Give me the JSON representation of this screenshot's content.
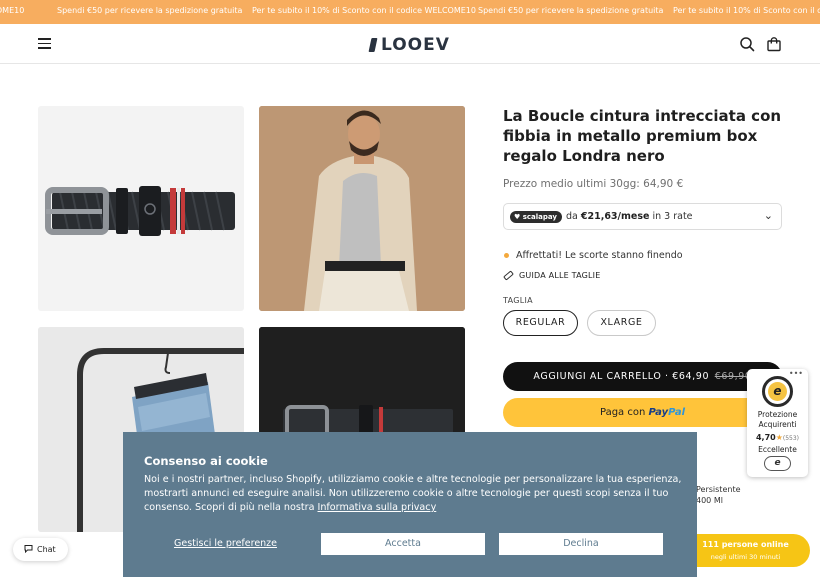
{
  "announcement": {
    "items": [
      "DME10",
      "Spendi €50 per ricevere la spedizione gratuita",
      "Per te subito il 10% di Sconto con il codice WELCOME10",
      "Spendi €50 per ricevere la spedizione gratuita",
      "Per te subito il 10% di Sconto con il codice"
    ],
    "color": "#f7ad5f"
  },
  "header": {
    "logo": "LOOEV",
    "icons": [
      "menu-icon",
      "search-icon",
      "bag-icon"
    ]
  },
  "product": {
    "title": "La Boucle cintura intrecciata con fibbia in metallo premium box regalo Londra nero",
    "avg_price": "Prezzo medio ultimi 30gg: 64,90 €",
    "scalapay": {
      "badge": "scalapay",
      "prefix": "da ",
      "amount": "€21,63/mese",
      "suffix": " in 3 rate"
    },
    "stock": "Affrettati! Le scorte stanno finendo",
    "size_guide": "GUIDA ALLE TAGLIE",
    "size_label": "TAGLIA",
    "sizes": [
      "REGULAR",
      "XLARGE"
    ],
    "add_to_cart": "AGGIUNGI AL CARRELLO · €64,90",
    "old_price": "€69,90",
    "paypal": {
      "prefix": "Paga con ",
      "brand1": "Pay",
      "brand2": "Pal"
    },
    "partial_text": [
      "Persistente",
      "400 Ml"
    ]
  },
  "trust": {
    "seal": "e",
    "label": "Protezione Acquirenti",
    "rating": "4,70",
    "star": "★",
    "count": "(553)",
    "quality": "Eccellente"
  },
  "proof": {
    "line1": "111 persone online",
    "line2": "negli ultimi 30 minuti"
  },
  "chat": {
    "label": "Chat"
  },
  "cookie": {
    "title": "Consenso ai cookie",
    "text": "Noi e i nostri partner, incluso Shopify, utilizziamo cookie e altre tecnologie per personalizzare la tua esperienza, mostrarti annunci ed eseguire analisi. Non utilizzeremo cookie o altre tecnologie per questi scopi senza il tuo consenso. Scopri di più nella nostra ",
    "link": "Informativa sulla privacy",
    "preferences": "Gestisci le preferenze",
    "accept": "Accetta",
    "decline": "Declina"
  }
}
